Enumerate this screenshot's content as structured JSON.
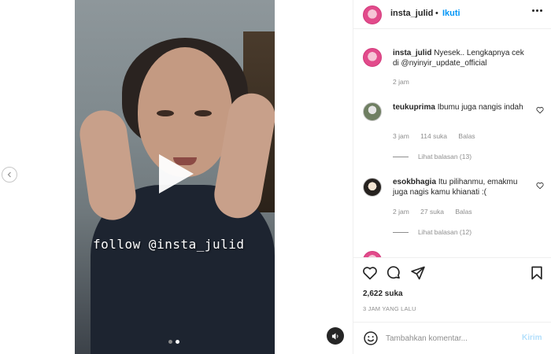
{
  "header": {
    "username": "insta_julid",
    "separator": "•",
    "follow_label": "Ikuti"
  },
  "media": {
    "overlay_text": "follow @insta_julid",
    "slide_count": 2,
    "active_slide": 2
  },
  "comments": [
    {
      "username": "insta_julid",
      "text": "Nyesek.. Lengkapnya cek di @nyinyir_update_official",
      "time": "2 jam"
    },
    {
      "username": "teukuprima",
      "text": "Ibumu juga nangis indah",
      "time": "3 jam",
      "likes": "114 suka",
      "reply_label": "Balas",
      "view_replies": "Lihat balasan (13)"
    },
    {
      "username": "esokbhagia",
      "text": "Itu pilihanmu, emakmu juga nagis kamu khianati :(",
      "time": "2 jam",
      "likes": "27 suka",
      "reply_label": "Balas",
      "view_replies": "Lihat balasan (12)"
    }
  ],
  "actions": {
    "likes": "2,622 suka",
    "timestamp": "3 JAM YANG LALU"
  },
  "compose": {
    "placeholder": "Tambahkan komentar...",
    "post_label": "Kirim"
  },
  "colors": {
    "accent": "#0095f6",
    "post_disabled": "#b2dffc",
    "muted": "#8e8e8e",
    "text": "#262626"
  },
  "icons": [
    "chevron-left-icon",
    "play-icon",
    "audio-icon",
    "more-icon",
    "heart-icon",
    "comment-icon",
    "share-icon",
    "bookmark-icon",
    "emoji-icon"
  ]
}
